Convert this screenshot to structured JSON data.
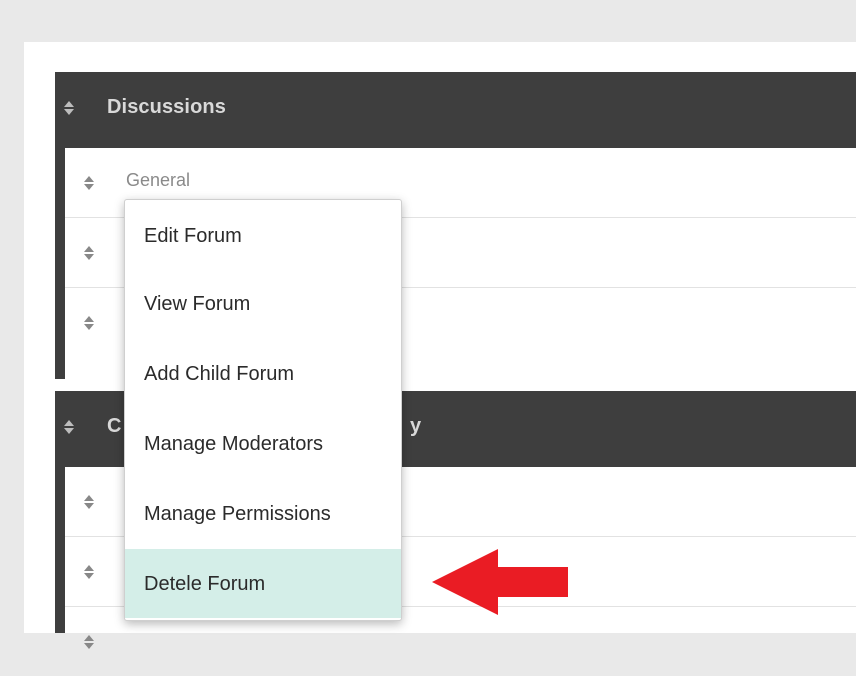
{
  "categories": [
    {
      "title": "Discussions",
      "forums": [
        {
          "name": "General"
        },
        {
          "name": ""
        },
        {
          "name": ""
        }
      ]
    },
    {
      "title_visible": "C",
      "title_tail_visible": "y",
      "forums": [
        {
          "name": ""
        },
        {
          "name": ""
        },
        {
          "name": ""
        }
      ]
    }
  ],
  "context_menu": {
    "items": [
      {
        "label": "Edit Forum"
      },
      {
        "label": "View Forum"
      },
      {
        "label": "Add Child Forum"
      },
      {
        "label": "Manage Moderators"
      },
      {
        "label": "Manage Permissions"
      },
      {
        "label": "Detele Forum",
        "highlighted": true
      }
    ]
  },
  "icons": {
    "drag_handle": "sort-arrows-icon",
    "annotation": "red-left-arrow"
  },
  "colors": {
    "category_bar": "#3e3e3e",
    "highlight": "#d4eee8",
    "annotation_arrow": "#ea1c24"
  }
}
